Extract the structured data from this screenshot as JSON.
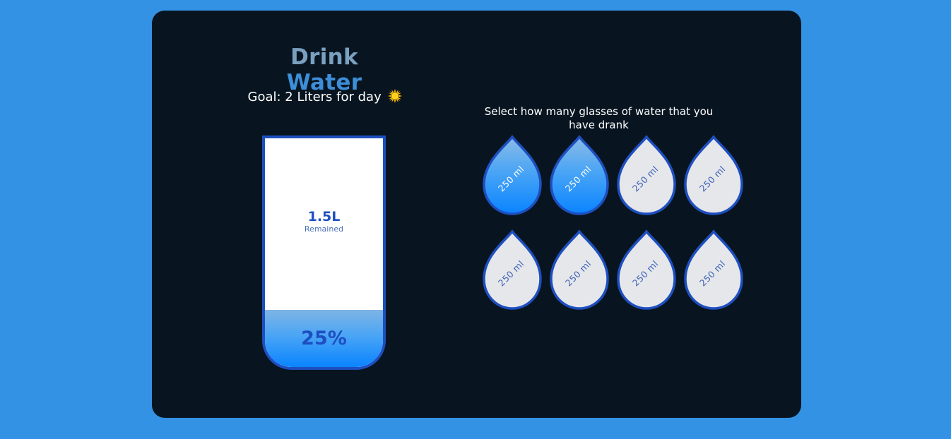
{
  "header": {
    "title_part1": "Drink",
    "title_part2": "Water"
  },
  "goal": {
    "text": "Goal: 2 Liters for day",
    "icon": "sun-icon"
  },
  "cup": {
    "remained_value": "1.5L",
    "remained_label": "Remained",
    "percentage_text": "25%",
    "fill_fraction": 0.25
  },
  "selector": {
    "instruction": "Select how many glasses of water that you have drank"
  },
  "glasses": [
    {
      "label": "250 ml",
      "filled": true
    },
    {
      "label": "250 ml",
      "filled": true
    },
    {
      "label": "250 ml",
      "filled": false
    },
    {
      "label": "250 ml",
      "filled": false
    },
    {
      "label": "250 ml",
      "filled": false
    },
    {
      "label": "250 ml",
      "filled": false
    },
    {
      "label": "250 ml",
      "filled": false
    },
    {
      "label": "250 ml",
      "filled": false
    }
  ],
  "colors": {
    "page_background": "#3392e3",
    "card_background": "#081520",
    "accent_blue": "#1e4fc0",
    "water_blue": "#0a84ff",
    "empty_glass": "#e6e7ea"
  }
}
